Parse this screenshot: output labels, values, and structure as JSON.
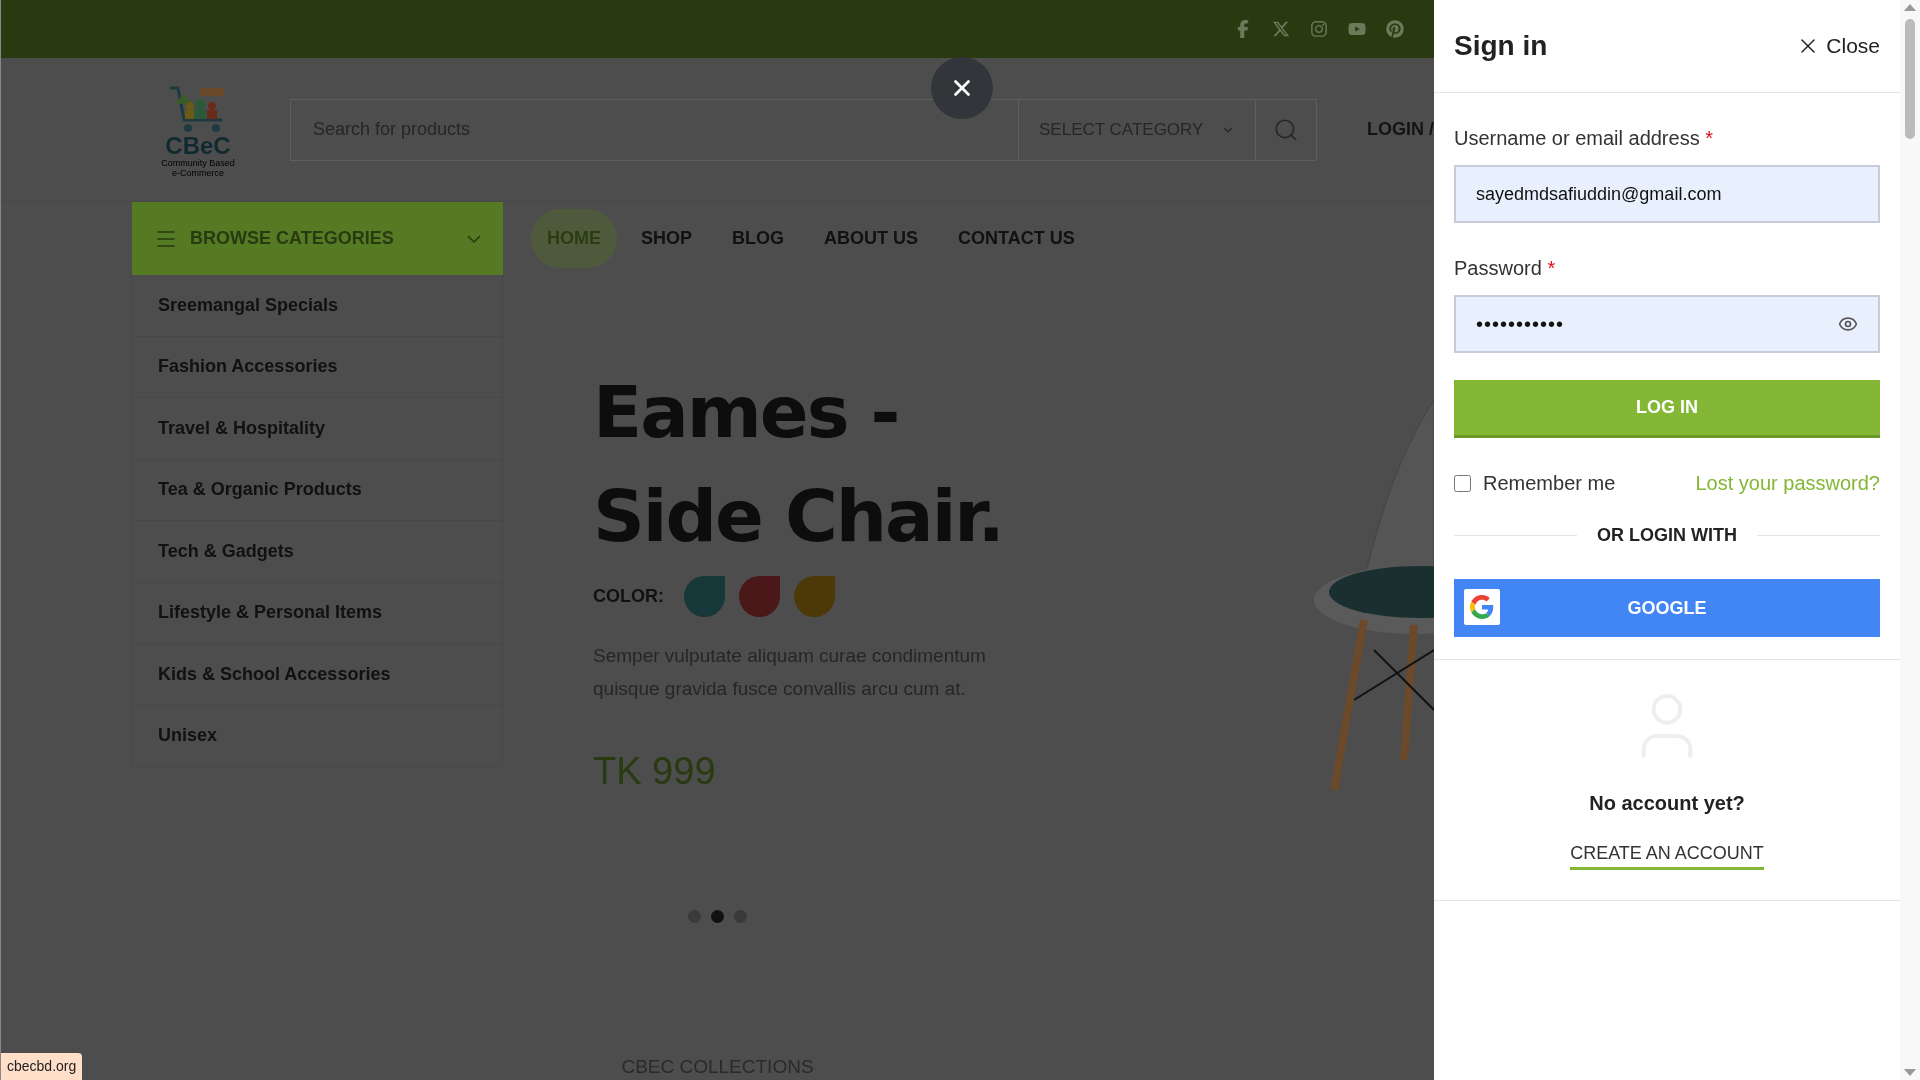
{
  "header": {
    "logo": {
      "title": "CBeC",
      "subtitle": "Community Based e-Commerce"
    },
    "search": {
      "placeholder": "Search for products"
    },
    "category_select": "SELECT CATEGORY",
    "login_link": "LOGIN /"
  },
  "browse_categories": {
    "label": "BROWSE CATEGORIES",
    "items": [
      "Sreemangal Specials",
      "Fashion Accessories",
      "Travel & Hospitality",
      "Tea & Organic Products",
      "Tech & Gadgets",
      "Lifestyle & Personal Items",
      "Kids & School Accessories",
      "Unisex"
    ]
  },
  "nav": [
    {
      "label": "HOME",
      "selected": true
    },
    {
      "label": "SHOP",
      "selected": false
    },
    {
      "label": "BLOG",
      "selected": false
    },
    {
      "label": "ABOUT US",
      "selected": false
    },
    {
      "label": "CONTACT US",
      "selected": false
    }
  ],
  "hero": {
    "title_lines": [
      "Eames -",
      "Side Chair."
    ],
    "color_label": "COLOR:",
    "swatches": [
      {
        "color": "#173838"
      },
      {
        "color": "#4a1818"
      },
      {
        "color": "#4d3808"
      }
    ],
    "description": "Semper vulputate aliquam curae condimentum quisque gravida fusce convallis arcu cum at.",
    "price": "TK 999",
    "slides": [
      {
        "selected": false
      },
      {
        "selected": true
      },
      {
        "selected": false
      }
    ]
  },
  "section_heading": "CBEC COLLECTIONS",
  "status_url": "cbecbd.org",
  "sign_in": {
    "title": "Sign in",
    "close": "Close",
    "username_label": "Username or email address",
    "username_value": "sayedmdsafiuddin@gmail.com",
    "password_label": "Password",
    "required_mark": "*",
    "password_value": "•••••••••••",
    "login_button": "LOG IN",
    "remember_label": "Remember me",
    "remember_checked": false,
    "lost_password": "Lost your password?",
    "or_login_with": "OR LOGIN WITH",
    "google_button": "GOOGLE",
    "no_account": "No account yet?",
    "create_account": "CREATE AN ACCOUNT"
  }
}
